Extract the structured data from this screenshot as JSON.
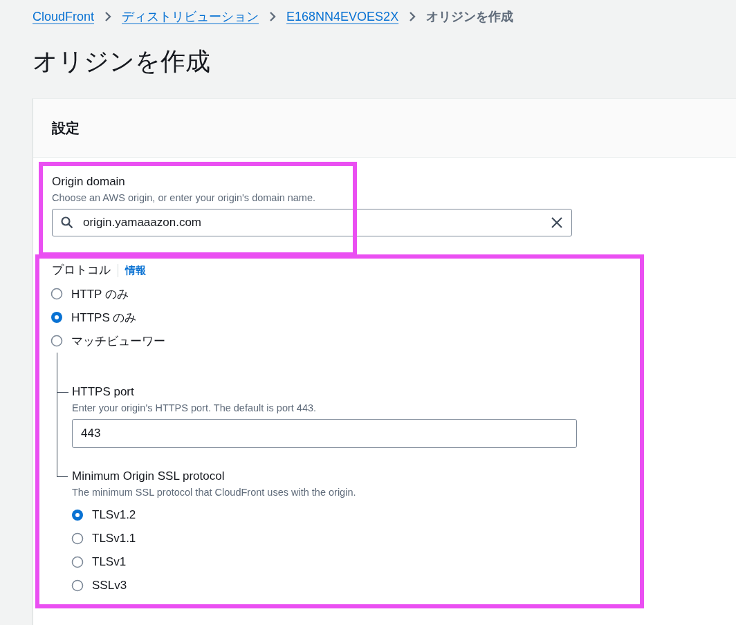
{
  "breadcrumbs": [
    {
      "label": "CloudFront",
      "kind": "link"
    },
    {
      "label": "ディストリビューション",
      "kind": "link"
    },
    {
      "label": "E168NN4EVOES2X",
      "kind": "link"
    },
    {
      "label": "オリジンを作成",
      "kind": "current"
    }
  ],
  "title": "オリジンを作成",
  "panel": {
    "header": "設定",
    "origin_domain": {
      "label": "Origin domain",
      "description": "Choose an AWS origin, or enter your origin's domain name.",
      "value": "origin.yamaaazon.com"
    },
    "protocol": {
      "label": "プロトコル",
      "info_link": "情報",
      "options": [
        {
          "label": "HTTP のみ",
          "selected": false
        },
        {
          "label": "HTTPS のみ",
          "selected": true
        },
        {
          "label": "マッチビューワー",
          "selected": false
        }
      ],
      "https_port": {
        "label": "HTTPS port",
        "description": "Enter your origin's HTTPS port. The default is port 443.",
        "value": "443"
      },
      "min_ssl": {
        "label": "Minimum Origin SSL protocol",
        "description": "The minimum SSL protocol that CloudFront uses with the origin.",
        "options": [
          {
            "label": "TLSv1.2",
            "selected": true
          },
          {
            "label": "TLSv1.1",
            "selected": false
          },
          {
            "label": "TLSv1",
            "selected": false
          },
          {
            "label": "SSLv3",
            "selected": false
          }
        ]
      }
    }
  }
}
